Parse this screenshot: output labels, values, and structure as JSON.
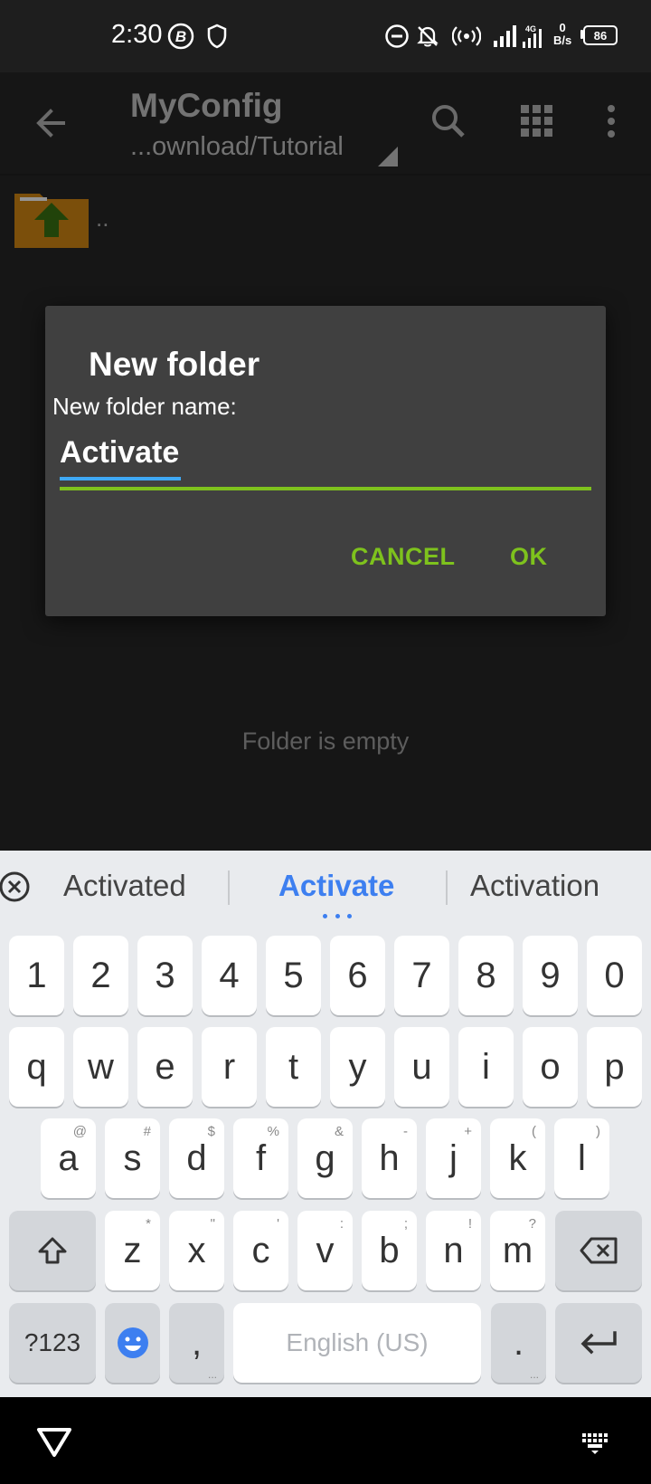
{
  "status_bar": {
    "time": "2:30",
    "net_speed_value": "0",
    "net_speed_unit": "B/s",
    "network_type": "4G",
    "battery_level": "86"
  },
  "app_bar": {
    "title": "MyConfig",
    "path": "...ownload/Tutorial"
  },
  "file_list": {
    "items": [
      {
        "name": "..",
        "icon": "folder-up-icon"
      }
    ],
    "empty_message": "Folder is empty"
  },
  "dialog": {
    "title": "New folder",
    "label": "New folder name:",
    "input_value": "Activate",
    "cancel_label": "CANCEL",
    "ok_label": "OK",
    "accent_color": "#7ec21d"
  },
  "keyboard": {
    "suggestions": [
      "Activated",
      "Activate",
      "Activation"
    ],
    "number_row": [
      "1",
      "2",
      "3",
      "4",
      "5",
      "6",
      "7",
      "8",
      "9",
      "0"
    ],
    "row1": [
      "q",
      "w",
      "e",
      "r",
      "t",
      "y",
      "u",
      "i",
      "o",
      "p"
    ],
    "row2": [
      {
        "k": "a",
        "h": "@"
      },
      {
        "k": "s",
        "h": "#"
      },
      {
        "k": "d",
        "h": "$"
      },
      {
        "k": "f",
        "h": "%"
      },
      {
        "k": "g",
        "h": "&"
      },
      {
        "k": "h",
        "h": "-"
      },
      {
        "k": "j",
        "h": "+"
      },
      {
        "k": "k",
        "h": "("
      },
      {
        "k": "l",
        "h": ")"
      }
    ],
    "row3": [
      {
        "k": "z",
        "h": "*"
      },
      {
        "k": "x",
        "h": "\""
      },
      {
        "k": "c",
        "h": "'"
      },
      {
        "k": "v",
        "h": ":"
      },
      {
        "k": "b",
        "h": ";"
      },
      {
        "k": "n",
        "h": "!"
      },
      {
        "k": "m",
        "h": "?"
      }
    ],
    "symbols_label": "?123",
    "comma_label": ",",
    "space_label": "English (US)",
    "period_label": ".",
    "suggestion_highlight_color": "#3d7ff0"
  }
}
